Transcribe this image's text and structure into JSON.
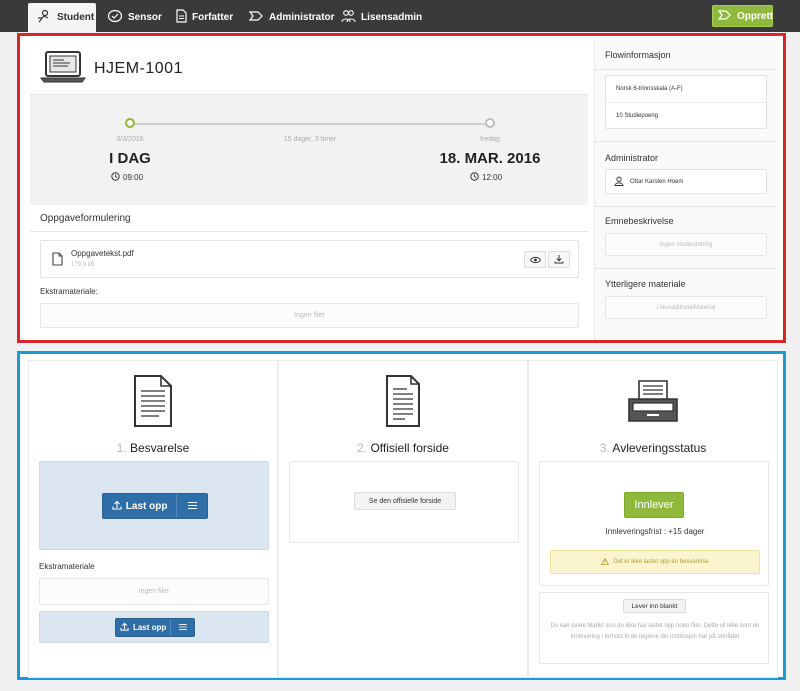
{
  "nav": {
    "tabs": [
      {
        "label": "Student",
        "icon": "student-icon",
        "active": true
      },
      {
        "label": "Sensor",
        "icon": "sensor-icon",
        "active": false
      },
      {
        "label": "Forfatter",
        "icon": "document-icon",
        "active": false
      },
      {
        "label": "Administrator",
        "icon": "admin-icon",
        "active": false
      },
      {
        "label": "Lisensadmin",
        "icon": "people-icon",
        "active": false
      }
    ],
    "create_label": "Opprett"
  },
  "assignment": {
    "code": "HJEM-1001",
    "start": {
      "date_small": "3/3/2016",
      "label": "I DAG",
      "time": "09:00"
    },
    "duration": "15 dager, 3 timer",
    "end": {
      "date_small": "fredag",
      "label": "18. MAR. 2016",
      "time": "12:00"
    },
    "task_title": "Oppgaveformulering",
    "file": {
      "name": "Oppgavetekst.pdf",
      "size": "179.9 kB"
    },
    "extra_label": "Ekstramateriale:",
    "extra_empty": "Ingen filer"
  },
  "sidebar": {
    "flow_title": "Flowinformasjon",
    "flow_rows": [
      "Norsk 6-trinnsskala (A-F)",
      "10 Studiepoeng"
    ],
    "admin_title": "Administrator",
    "admin_name": "Ottar Karsten Hoem",
    "course_title": "Emnebeskrivelse",
    "course_value": "Ingen studieordning",
    "more_title": "Ytterligere materiale",
    "more_value": "i.NoAdditionalMaterial"
  },
  "steps": {
    "answer": {
      "num": "1.",
      "title": "Besvarelse",
      "upload_label": "Last opp",
      "extra_label": "Ekstramateriale",
      "extra_empty": "Ingen filer",
      "extra_upload_label": "Last opp"
    },
    "cover": {
      "num": "2.",
      "title": "Offisiell forside",
      "button_label": "Se den offisielle forside"
    },
    "status": {
      "num": "3.",
      "title": "Avleveringsstatus",
      "deliver_label": "Innlever",
      "deadline": "Innleveringsfrist : +15 dager",
      "warning": "Det er ikke lastet opp en besvarelse",
      "blank_button": "Lever inn blankt",
      "blank_desc": "Du kan svare blankt viss du ikke har lastet opp noen filer. Dette vil telle som en innlevering i forhold til de reglene din institusjon har på området"
    }
  },
  "colors": {
    "accent_green": "#8fb93d",
    "primary_blue": "#2f6fa8",
    "frame_red": "#d9262e",
    "frame_blue": "#1b9bd6"
  }
}
